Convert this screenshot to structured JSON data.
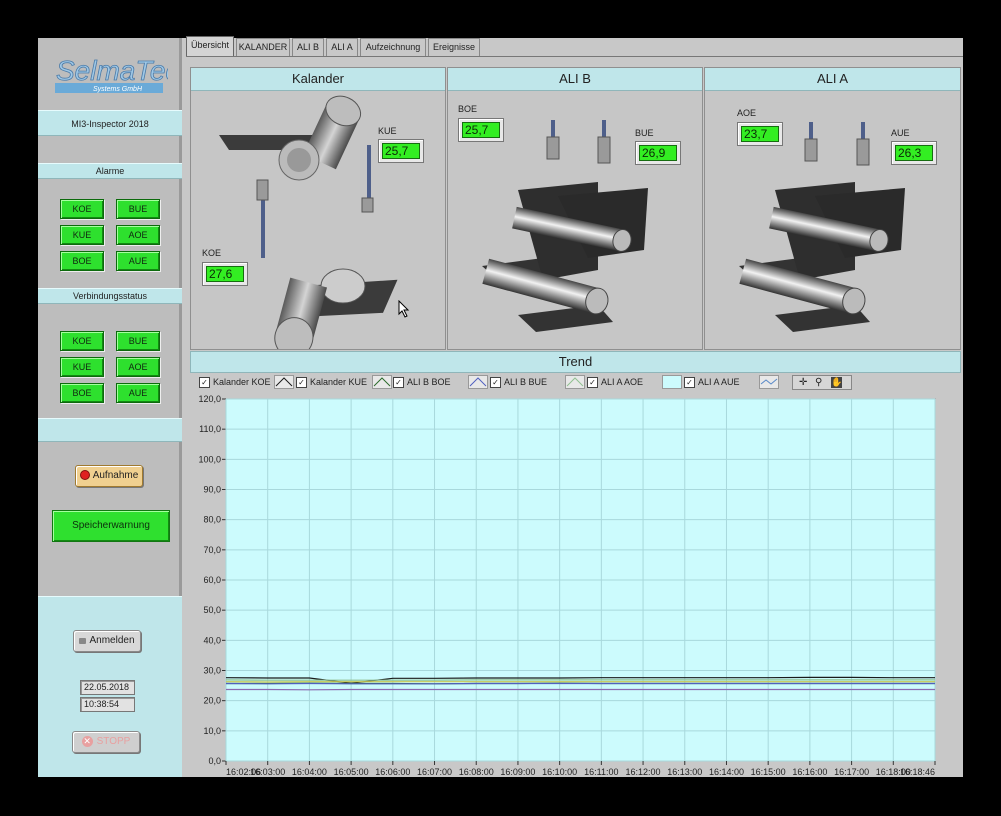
{
  "tabs": [
    "Übersicht",
    "KALANDER",
    "ALI B",
    "ALI A",
    "Aufzeichnung",
    "Ereignisse"
  ],
  "sidebar": {
    "logo_main": "SelmaTec",
    "logo_sub": "Systems GmbH",
    "app_name": "MI3-Inspector 2018",
    "alarme_label": "Alarme",
    "alarme": [
      "KOE",
      "BUE",
      "KUE",
      "AOE",
      "BOE",
      "AUE"
    ],
    "verbindung_label": "Verbindungsstatus",
    "verbindung": [
      "KOE",
      "BUE",
      "KUE",
      "AOE",
      "BOE",
      "AUE"
    ],
    "record_button": "Aufnahme",
    "storage_warning": "Speicherwarnung",
    "login_button": "Anmelden",
    "date": "22.05.2018",
    "time": "10:38:54",
    "stop_button": "STOPP"
  },
  "panels": {
    "kalander": {
      "title": "Kalander",
      "kue_label": "KUE",
      "kue_value": "25,7",
      "koe_label": "KOE",
      "koe_value": "27,6"
    },
    "alib": {
      "title": "ALI B",
      "boe_label": "BOE",
      "boe_value": "25,7",
      "bue_label": "BUE",
      "bue_value": "26,9"
    },
    "alia": {
      "title": "ALI A",
      "aoe_label": "AOE",
      "aoe_value": "23,7",
      "aue_label": "AUE",
      "aue_value": "26,3"
    }
  },
  "trend": {
    "title": "Trend",
    "legend": [
      "Kalander KOE",
      "Kalander KUE",
      "ALI B BOE",
      "ALI B BUE",
      "ALI A AOE",
      "ALI A AUE"
    ]
  },
  "colors": {
    "accent": "#bfe6ea",
    "indicator": "#2ee02e",
    "plot_bg": "#ccfbfd",
    "grid": "#a8d8dc"
  },
  "chart_data": {
    "type": "line",
    "title": "Trend",
    "xlabel": "",
    "ylabel": "",
    "ylim": [
      0,
      120
    ],
    "y_ticks": [
      "0,0",
      "10,0",
      "20,0",
      "30,0",
      "40,0",
      "50,0",
      "60,0",
      "70,0",
      "80,0",
      "90,0",
      "100,0",
      "110,0",
      "120,0"
    ],
    "x_ticks": [
      "16:02:06",
      "16:03:00",
      "16:04:00",
      "16:05:00",
      "16:06:00",
      "16:07:00",
      "16:08:00",
      "16:09:00",
      "16:10:00",
      "16:11:00",
      "16:12:00",
      "16:13:00",
      "16:14:00",
      "16:15:00",
      "16:16:00",
      "16:17:00",
      "16:18:00",
      "16:18:46"
    ],
    "x": [
      "16:02:06",
      "16:03:00",
      "16:04:00",
      "16:05:00",
      "16:06:00",
      "16:07:00",
      "16:08:00",
      "16:09:00",
      "16:10:00",
      "16:11:00",
      "16:12:00",
      "16:13:00",
      "16:14:00",
      "16:15:00",
      "16:16:00",
      "16:17:00",
      "16:18:00",
      "16:18:46"
    ],
    "grid": true,
    "series": [
      {
        "name": "Kalander KOE",
        "color": "#1a1a1a",
        "values": [
          27.6,
          27.5,
          27.5,
          25.8,
          27.4,
          27.4,
          27.5,
          27.5,
          27.5,
          27.6,
          27.6,
          27.6,
          27.6,
          27.6,
          27.7,
          27.7,
          27.6,
          27.6
        ]
      },
      {
        "name": "Kalander KUE",
        "color": "#2a6a2a",
        "values": [
          25.7,
          25.7,
          25.8,
          25.7,
          25.7,
          25.6,
          25.7,
          25.7,
          25.8,
          25.7,
          25.7,
          25.7,
          25.7,
          25.7,
          25.7,
          25.7,
          25.7,
          25.7
        ]
      },
      {
        "name": "ALI B BOE",
        "color": "#5060c0",
        "values": [
          25.7,
          25.6,
          25.7,
          25.6,
          25.6,
          25.6,
          25.7,
          25.7,
          25.7,
          25.7,
          25.7,
          25.7,
          25.7,
          25.7,
          25.7,
          25.7,
          25.7,
          25.7
        ]
      },
      {
        "name": "ALI B BUE",
        "color": "#90c090",
        "values": [
          26.9,
          26.8,
          26.8,
          26.8,
          26.8,
          26.8,
          26.9,
          26.9,
          26.9,
          26.9,
          26.9,
          26.9,
          26.9,
          26.9,
          26.9,
          26.9,
          26.9,
          26.9
        ]
      },
      {
        "name": "ALI A AOE",
        "color": "#8a6ab0",
        "values": [
          23.7,
          23.7,
          23.6,
          23.7,
          23.7,
          23.7,
          23.7,
          23.7,
          23.7,
          23.7,
          23.7,
          23.7,
          23.7,
          23.7,
          23.7,
          23.7,
          23.7,
          23.7
        ]
      },
      {
        "name": "ALI A AUE",
        "color": "#c8c850",
        "values": [
          26.3,
          26.2,
          26.3,
          26.3,
          26.3,
          26.3,
          26.3,
          26.3,
          26.3,
          26.3,
          26.3,
          26.3,
          26.3,
          26.3,
          26.3,
          26.3,
          26.3,
          26.3
        ]
      }
    ]
  }
}
